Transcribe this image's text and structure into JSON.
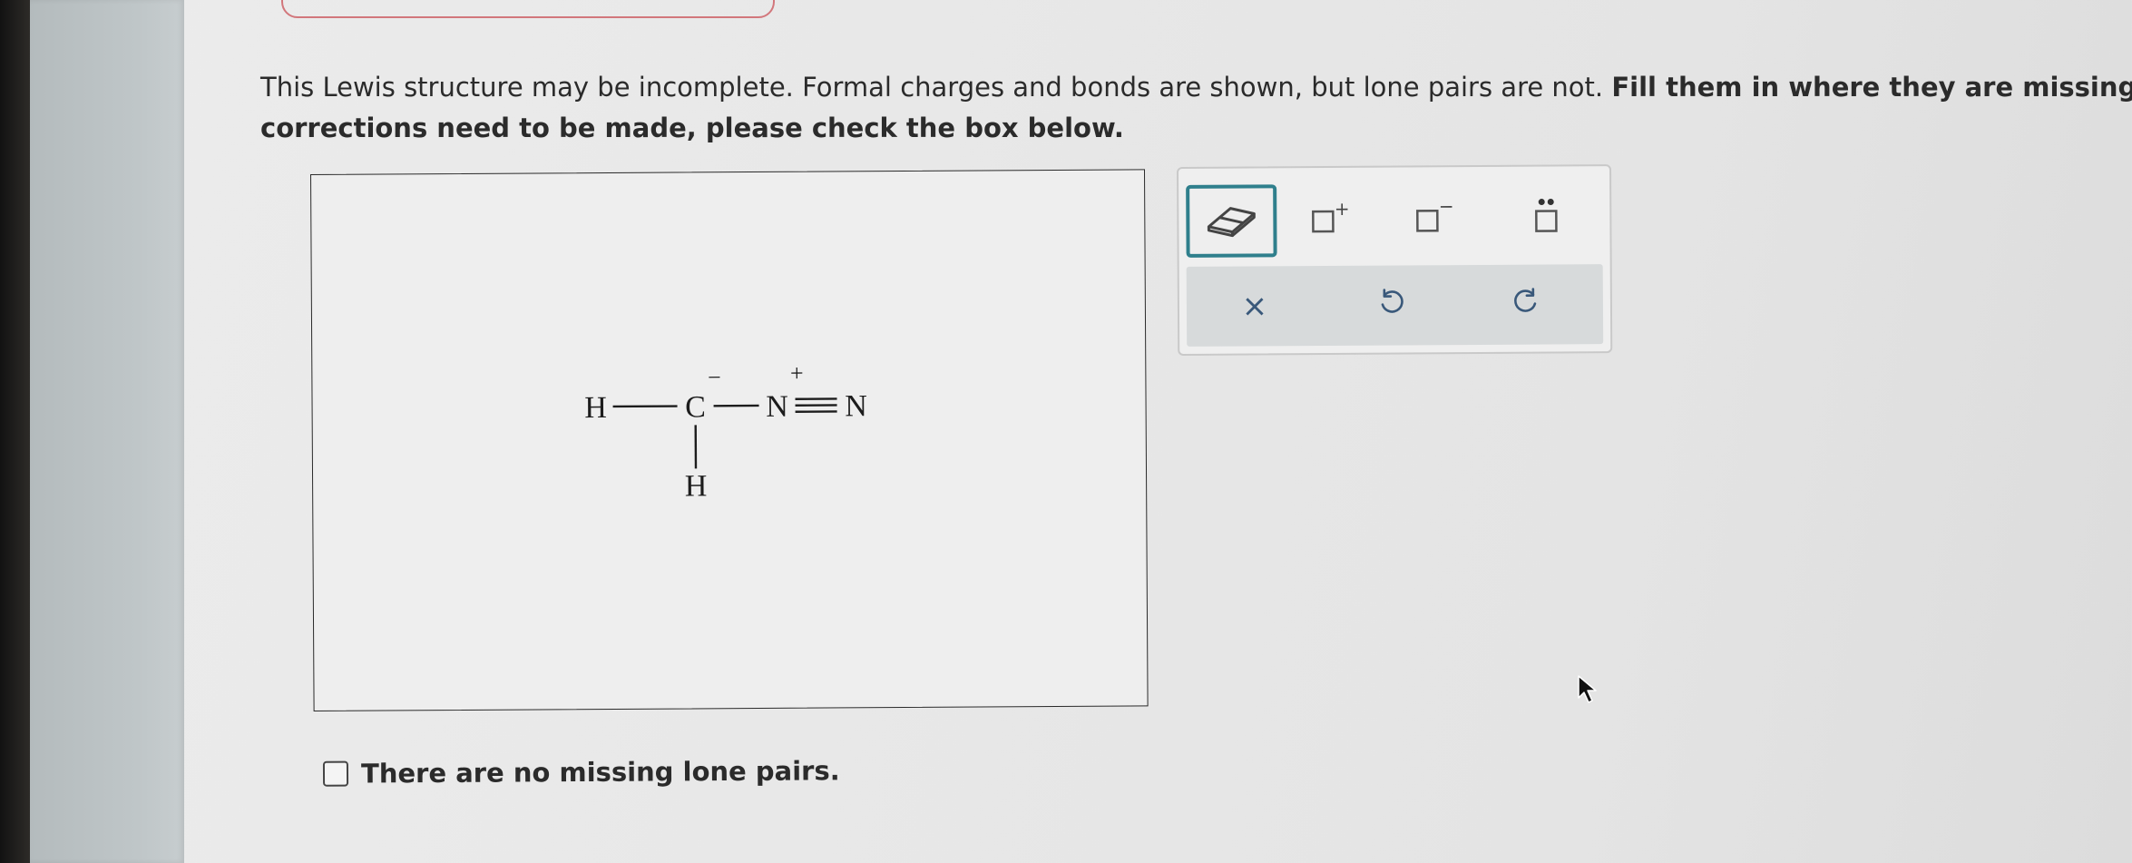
{
  "instructions": {
    "part1": "This Lewis structure may be incomplete. Formal charges and bonds are shown, but lone pairs are not. ",
    "part2_bold": "Fill them in where they are missing. If no",
    "line2_bold": "corrections need to be made, please check the box below."
  },
  "molecule": {
    "atoms": {
      "h_left": "H",
      "c": "C",
      "n1": "N",
      "n2": "N",
      "h_bottom": "H"
    },
    "charges": {
      "c_charge": "−",
      "n1_charge": "+"
    }
  },
  "toolbar": {
    "tools": [
      {
        "name": "eraser",
        "icon": "eraser-icon",
        "selected": true
      },
      {
        "name": "positive-charge",
        "icon": "positive-charge-icon",
        "glyph": "+"
      },
      {
        "name": "negative-charge",
        "icon": "negative-charge-icon",
        "glyph": "−"
      },
      {
        "name": "lone-pair",
        "icon": "lone-pair-icon"
      }
    ],
    "actions": {
      "clear": "×",
      "undo": "undo-icon",
      "redo": "redo-icon"
    }
  },
  "checkbox": {
    "label": "There are no missing lone pairs.",
    "checked": false
  },
  "colors": {
    "accent": "#2f7f8c",
    "action_icon": "#39587a",
    "top_box_border": "#d2777c"
  }
}
